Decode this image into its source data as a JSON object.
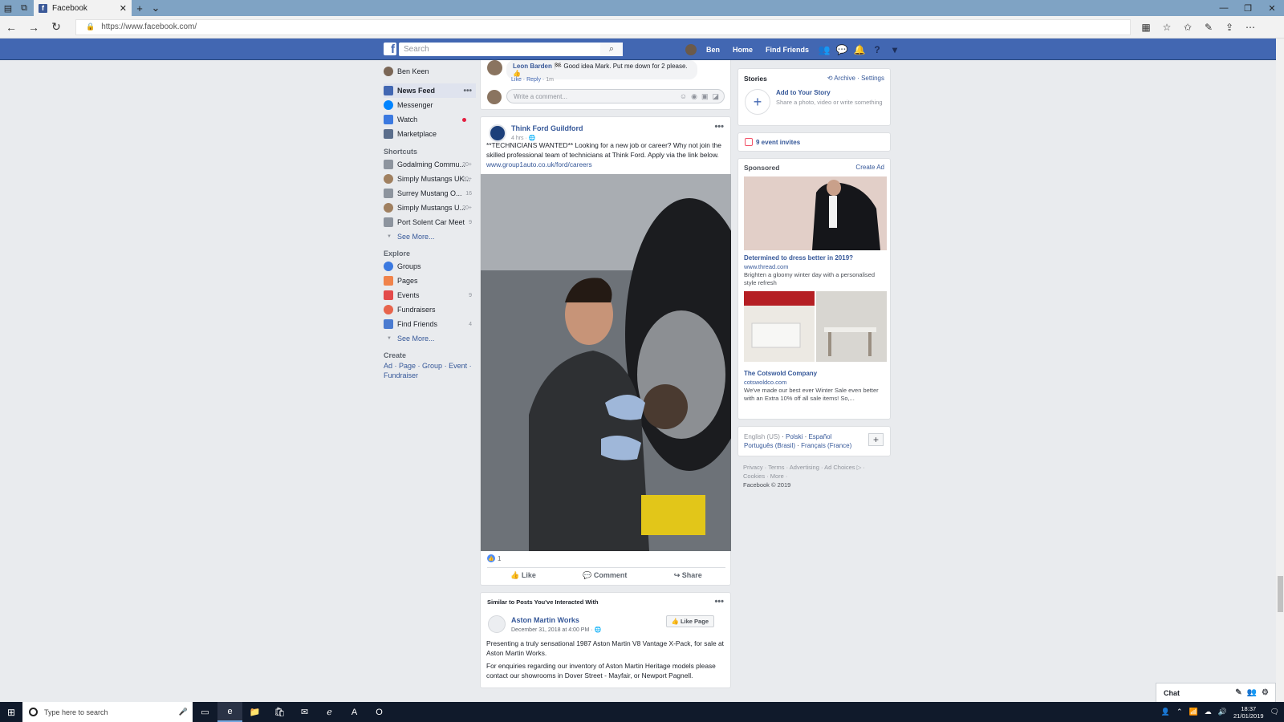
{
  "browser": {
    "tab_title": "Facebook",
    "url": "https://www.facebook.com/"
  },
  "fb": {
    "search_placeholder": "Search",
    "user_short": "Ben",
    "nav_home": "Home",
    "nav_find_friends": "Find Friends"
  },
  "left_nav": {
    "user_name": "Ben Keen",
    "main": [
      {
        "label": "News Feed",
        "icon": "news-feed-icon",
        "color": "#4267b2"
      },
      {
        "label": "Messenger",
        "icon": "messenger-icon",
        "color": "#0084ff"
      },
      {
        "label": "Watch",
        "icon": "watch-icon",
        "color": "#3b79e0"
      },
      {
        "label": "Marketplace",
        "icon": "marketplace-icon",
        "color": "#5b6e8c"
      }
    ],
    "shortcuts_title": "Shortcuts",
    "shortcuts": [
      {
        "label": "Godalming Commu...",
        "count": "20+"
      },
      {
        "label": "Simply Mustangs UK...",
        "count": "20+"
      },
      {
        "label": "Surrey Mustang O...",
        "count": "16"
      },
      {
        "label": "Simply Mustangs U...",
        "count": "20+"
      },
      {
        "label": "Port Solent Car Meet",
        "count": "9"
      }
    ],
    "see_more": "See More...",
    "explore_title": "Explore",
    "explore": [
      {
        "label": "Groups",
        "count": "",
        "color": "#3b79e0"
      },
      {
        "label": "Pages",
        "count": "",
        "color": "#f0834b"
      },
      {
        "label": "Events",
        "count": "9",
        "color": "#e34a4a"
      },
      {
        "label": "Fundraisers",
        "count": "",
        "color": "#e7644c"
      },
      {
        "label": "Find Friends",
        "count": "4",
        "color": "#4a7bd0"
      }
    ],
    "create_title": "Create",
    "create_links": [
      "Ad",
      "Page",
      "Group",
      "Event",
      "Fundraiser"
    ]
  },
  "comment": {
    "name": "Leon Barden",
    "text": "Good idea Mark. Put me down for 2 please.",
    "like": "Like",
    "reply": "Reply",
    "time": "1m",
    "write_placeholder": "Write a comment..."
  },
  "post": {
    "page_name": "Think Ford Guildford",
    "time": "4 hrs",
    "text": "**TECHNICIANS WANTED** Looking for a new job or career? Why not join the skilled professional team of technicians at Think Ford. Apply via the link below.",
    "link": "www.group1auto.co.uk/ford/careers",
    "reaction_count": "1",
    "like": "Like",
    "comment": "Comment",
    "share": "Share"
  },
  "similar": {
    "header": "Similar to Posts You've Interacted With",
    "page_name": "Aston Martin Works",
    "date": "December 31, 2018 at 4:00 PM",
    "like_page": "Like Page",
    "text1": "Presenting a truly sensational 1987 Aston Martin V8 Vantage X-Pack, for sale at Aston Martin Works.",
    "text2": "For enquiries regarding our inventory of Aston Martin Heritage models please contact our showrooms in Dover Street - Mayfair, or Newport Pagnell."
  },
  "stories": {
    "title": "Stories",
    "archive": "Archive",
    "settings": "Settings",
    "add": "Add to Your Story",
    "sub": "Share a photo, video or write something"
  },
  "events": {
    "label": "9 event invites"
  },
  "sponsored": {
    "title": "Sponsored",
    "create_ad": "Create Ad",
    "ad1_title": "Determined to dress better in 2019?",
    "ad1_url": "www.thread.com",
    "ad1_desc": "Brighten a gloomy winter day with a personalised style refresh",
    "ad2_title": "The Cotswold Company",
    "ad2_url": "cotswoldco.com",
    "ad2_desc": "We've made our best ever Winter Sale even better with an Extra 10% off all sale items! So,..."
  },
  "languages": {
    "current": "English (US)",
    "others": [
      "Polski",
      "Español",
      "Português (Brasil)",
      "Français (France)"
    ]
  },
  "footer": {
    "links1": "Privacy · Terms · Advertising · Ad Choices ▷ ·",
    "links2": "Cookies · More ·",
    "copyright": "Facebook © 2019"
  },
  "chat": {
    "label": "Chat"
  },
  "taskbar": {
    "search_placeholder": "Type here to search",
    "time": "18:37",
    "date": "21/01/2019"
  }
}
